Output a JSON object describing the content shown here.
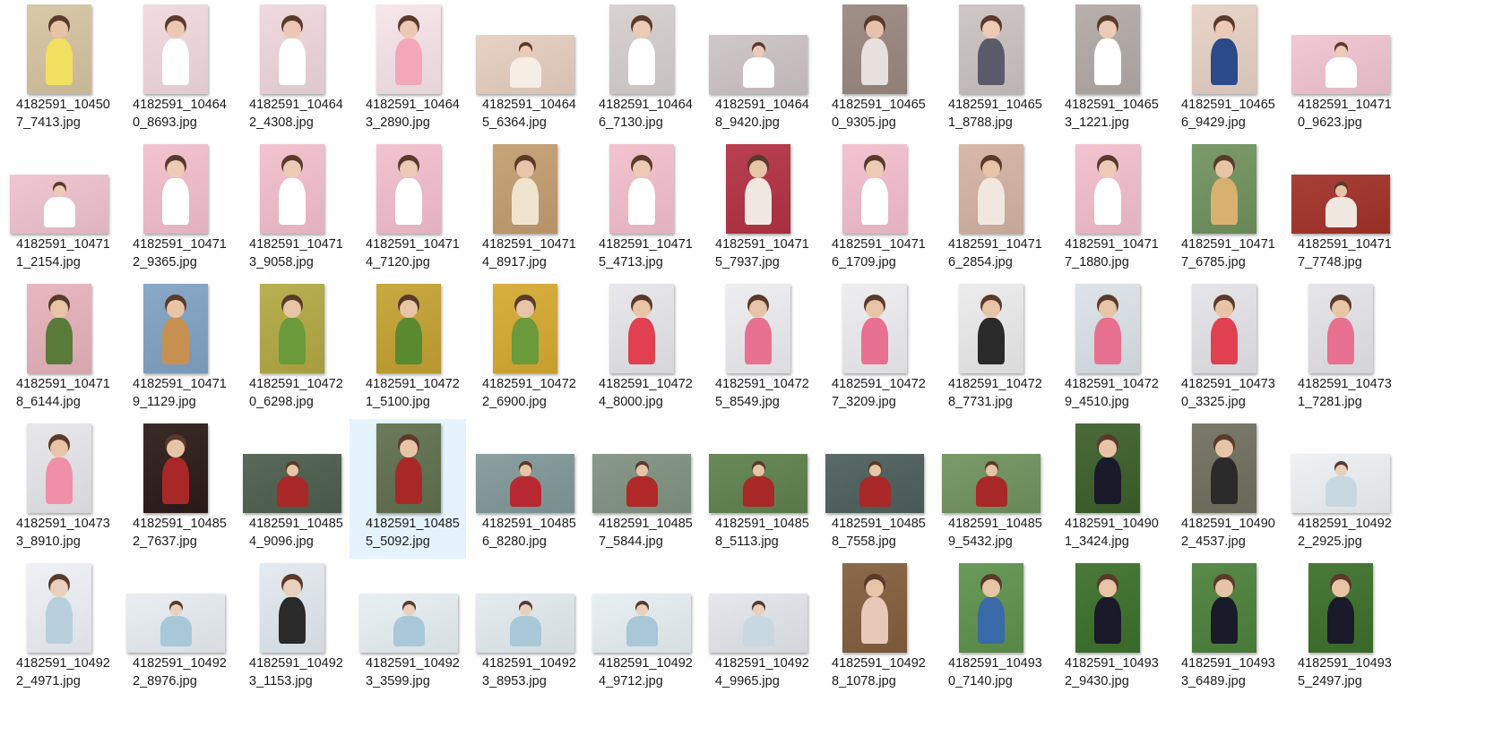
{
  "selected_index": 39,
  "files": [
    {
      "line1": "4182591_10450",
      "line2": "7_7413.jpg",
      "orient": "portrait",
      "bg": "#d9c8a8",
      "fg": "#f2e060",
      "skin": "#e8c2a4"
    },
    {
      "line1": "4182591_10464",
      "line2": "0_8693.jpg",
      "orient": "portrait",
      "bg": "#f3dbe2",
      "fg": "#ffffff",
      "skin": "#ecc8b4"
    },
    {
      "line1": "4182591_10464",
      "line2": "2_4308.jpg",
      "orient": "portrait",
      "bg": "#f0dade",
      "fg": "#ffffff",
      "skin": "#ecc8b4"
    },
    {
      "line1": "4182591_10464",
      "line2": "3_2890.jpg",
      "orient": "portrait",
      "bg": "#f7e6ea",
      "fg": "#f3a7b8",
      "skin": "#ecc8b4"
    },
    {
      "line1": "4182591_10464",
      "line2": "5_6364.jpg",
      "orient": "landscape",
      "bg": "#e8d2c4",
      "fg": "#f6ede6",
      "skin": "#eccab6"
    },
    {
      "line1": "4182591_10464",
      "line2": "6_7130.jpg",
      "orient": "portrait",
      "bg": "#d8d2d0",
      "fg": "#ffffff",
      "skin": "#eccab6"
    },
    {
      "line1": "4182591_10464",
      "line2": "8_9420.jpg",
      "orient": "landscape",
      "bg": "#cfc8c6",
      "fg": "#ffffff",
      "skin": "#eccab6"
    },
    {
      "line1": "4182591_10465",
      "line2": "0_9305.jpg",
      "orient": "portrait",
      "bg": "#a09088",
      "fg": "#e8e0dc",
      "skin": "#e6c2ae"
    },
    {
      "line1": "4182591_10465",
      "line2": "1_8788.jpg",
      "orient": "portrait",
      "bg": "#cfc7c6",
      "fg": "#5a5a6a",
      "skin": "#eccab6"
    },
    {
      "line1": "4182591_10465",
      "line2": "3_1221.jpg",
      "orient": "portrait",
      "bg": "#b8b0ac",
      "fg": "#ffffff",
      "skin": "#eccab6"
    },
    {
      "line1": "4182591_10465",
      "line2": "6_9429.jpg",
      "orient": "portrait",
      "bg": "#e8d4c8",
      "fg": "#2a4a8a",
      "skin": "#eccab6"
    },
    {
      "line1": "4182591_10471",
      "line2": "0_9623.jpg",
      "orient": "landscape",
      "bg": "#f2c8d4",
      "fg": "#ffffff",
      "skin": "#eccab6"
    },
    {
      "line1": "4182591_10471",
      "line2": "1_2154.jpg",
      "orient": "landscape",
      "bg": "#f0c6d2",
      "fg": "#ffffff",
      "skin": "#eccab6"
    },
    {
      "line1": "4182591_10471",
      "line2": "2_9365.jpg",
      "orient": "portrait",
      "bg": "#f3c4d0",
      "fg": "#ffffff",
      "skin": "#eccab6"
    },
    {
      "line1": "4182591_10471",
      "line2": "3_9058.jpg",
      "orient": "portrait",
      "bg": "#f3c4d0",
      "fg": "#ffffff",
      "skin": "#eccab6"
    },
    {
      "line1": "4182591_10471",
      "line2": "4_7120.jpg",
      "orient": "portrait",
      "bg": "#f3c4d0",
      "fg": "#ffffff",
      "skin": "#eccab6"
    },
    {
      "line1": "4182591_10471",
      "line2": "4_8917.jpg",
      "orient": "portrait",
      "bg": "#c8a47a",
      "fg": "#efe4d0",
      "skin": "#e8c4a6"
    },
    {
      "line1": "4182591_10471",
      "line2": "5_4713.jpg",
      "orient": "portrait",
      "bg": "#f3c4d0",
      "fg": "#ffffff",
      "skin": "#eccab6"
    },
    {
      "line1": "4182591_10471",
      "line2": "5_7937.jpg",
      "orient": "portrait",
      "bg": "#b84050",
      "fg": "#f0e8e0",
      "skin": "#e8c4a6"
    },
    {
      "line1": "4182591_10471",
      "line2": "6_1709.jpg",
      "orient": "portrait",
      "bg": "#f3c4d0",
      "fg": "#ffffff",
      "skin": "#eccab6"
    },
    {
      "line1": "4182591_10471",
      "line2": "6_2854.jpg",
      "orient": "portrait",
      "bg": "#d8b8a8",
      "fg": "#f0e8e0",
      "skin": "#e8c4a6"
    },
    {
      "line1": "4182591_10471",
      "line2": "7_1880.jpg",
      "orient": "portrait",
      "bg": "#f3c4d0",
      "fg": "#ffffff",
      "skin": "#eccab6"
    },
    {
      "line1": "4182591_10471",
      "line2": "7_6785.jpg",
      "orient": "portrait",
      "bg": "#7a9a6a",
      "fg": "#d8b070",
      "skin": "#e8c4a6"
    },
    {
      "line1": "4182591_10471",
      "line2": "7_7748.jpg",
      "orient": "landscape",
      "bg": "#a84038",
      "fg": "#f0e8e0",
      "skin": "#e8c4a6"
    },
    {
      "line1": "4182591_10471",
      "line2": "8_6144.jpg",
      "orient": "portrait",
      "bg": "#e8b8c0",
      "fg": "#5a7a3a",
      "skin": "#e8c4a6"
    },
    {
      "line1": "4182591_10471",
      "line2": "9_1129.jpg",
      "orient": "portrait",
      "bg": "#8aa8c8",
      "fg": "#c89050",
      "skin": "#e8c4a6"
    },
    {
      "line1": "4182591_10472",
      "line2": "0_6298.jpg",
      "orient": "portrait",
      "bg": "#b8b050",
      "fg": "#6a9a3a",
      "skin": "#e8c4a6"
    },
    {
      "line1": "4182591_10472",
      "line2": "1_5100.jpg",
      "orient": "portrait",
      "bg": "#c8a840",
      "fg": "#5a8a30",
      "skin": "#e8c4a6"
    },
    {
      "line1": "4182591_10472",
      "line2": "2_6900.jpg",
      "orient": "portrait",
      "bg": "#d8b040",
      "fg": "#6a9a3a",
      "skin": "#e8c4a6"
    },
    {
      "line1": "4182591_10472",
      "line2": "4_8000.jpg",
      "orient": "portrait",
      "bg": "#e8e8ec",
      "fg": "#e04050",
      "skin": "#e8c4a6"
    },
    {
      "line1": "4182591_10472",
      "line2": "5_8549.jpg",
      "orient": "portrait",
      "bg": "#eeeef0",
      "fg": "#e87090",
      "skin": "#e8c4a6"
    },
    {
      "line1": "4182591_10472",
      "line2": "7_3209.jpg",
      "orient": "portrait",
      "bg": "#eeeef0",
      "fg": "#e87090",
      "skin": "#e8c4a6"
    },
    {
      "line1": "4182591_10472",
      "line2": "8_7731.jpg",
      "orient": "portrait",
      "bg": "#ececec",
      "fg": "#2a2a2a",
      "skin": "#e8c4a6"
    },
    {
      "line1": "4182591_10472",
      "line2": "9_4510.jpg",
      "orient": "portrait",
      "bg": "#dde4ea",
      "fg": "#e87090",
      "skin": "#e8c4a6"
    },
    {
      "line1": "4182591_10473",
      "line2": "0_3325.jpg",
      "orient": "portrait",
      "bg": "#e6e6ea",
      "fg": "#e04050",
      "skin": "#e8c4a6"
    },
    {
      "line1": "4182591_10473",
      "line2": "1_7281.jpg",
      "orient": "portrait",
      "bg": "#e6e6ea",
      "fg": "#e87090",
      "skin": "#e8c4a6"
    },
    {
      "line1": "4182591_10473",
      "line2": "3_8910.jpg",
      "orient": "portrait",
      "bg": "#e8e8ec",
      "fg": "#f090a8",
      "skin": "#e8c4a6"
    },
    {
      "line1": "4182591_10485",
      "line2": "2_7637.jpg",
      "orient": "portrait",
      "bg": "#3a2a28",
      "fg": "#a82828",
      "skin": "#e8c4a6"
    },
    {
      "line1": "4182591_10485",
      "line2": "4_9096.jpg",
      "orient": "landscape",
      "bg": "#5a6a5a",
      "fg": "#a82828",
      "skin": "#e8c4a6"
    },
    {
      "line1": "4182591_10485",
      "line2": "5_5092.jpg",
      "orient": "portrait",
      "bg": "#6a7a5a",
      "fg": "#a82828",
      "skin": "#e8c4a6"
    },
    {
      "line1": "4182591_10485",
      "line2": "6_8280.jpg",
      "orient": "landscape",
      "bg": "#8aa0a0",
      "fg": "#b82830",
      "skin": "#e8c4a6"
    },
    {
      "line1": "4182591_10485",
      "line2": "7_5844.jpg",
      "orient": "landscape",
      "bg": "#8a9a8a",
      "fg": "#b02828",
      "skin": "#e8c4a6"
    },
    {
      "line1": "4182591_10485",
      "line2": "8_5113.jpg",
      "orient": "landscape",
      "bg": "#6a8a5a",
      "fg": "#a82828",
      "skin": "#e8c4a6"
    },
    {
      "line1": "4182591_10485",
      "line2": "8_7558.jpg",
      "orient": "landscape",
      "bg": "#5a6a68",
      "fg": "#a82828",
      "skin": "#e8c4a6"
    },
    {
      "line1": "4182591_10485",
      "line2": "9_5432.jpg",
      "orient": "landscape",
      "bg": "#7a9a6a",
      "fg": "#a82828",
      "skin": "#e8c4a6"
    },
    {
      "line1": "4182591_10490",
      "line2": "1_3424.jpg",
      "orient": "portrait",
      "bg": "#4a6a3a",
      "fg": "#1a1a2a",
      "skin": "#e8c4a6"
    },
    {
      "line1": "4182591_10490",
      "line2": "2_4537.jpg",
      "orient": "portrait",
      "bg": "#7a7a6a",
      "fg": "#2a2a2a",
      "skin": "#e8c4a6"
    },
    {
      "line1": "4182591_10492",
      "line2": "2_2925.jpg",
      "orient": "landscape",
      "bg": "#eef2f4",
      "fg": "#c8d8e0",
      "skin": "#e8d0bc"
    },
    {
      "line1": "4182591_10492",
      "line2": "2_4971.jpg",
      "orient": "portrait",
      "bg": "#eef2f6",
      "fg": "#b8d0dc",
      "skin": "#e8d0bc"
    },
    {
      "line1": "4182591_10492",
      "line2": "2_8976.jpg",
      "orient": "landscape",
      "bg": "#e8eef2",
      "fg": "#a8c8d8",
      "skin": "#e8d0bc"
    },
    {
      "line1": "4182591_10492",
      "line2": "3_1153.jpg",
      "orient": "portrait",
      "bg": "#e4ebf0",
      "fg": "#2a2a2a",
      "skin": "#e8d0bc"
    },
    {
      "line1": "4182591_10492",
      "line2": "3_3599.jpg",
      "orient": "landscape",
      "bg": "#e8f0f4",
      "fg": "#a8c8d8",
      "skin": "#e8d0bc"
    },
    {
      "line1": "4182591_10492",
      "line2": "3_8953.jpg",
      "orient": "landscape",
      "bg": "#e4ecf0",
      "fg": "#a8c8d8",
      "skin": "#e8d0bc"
    },
    {
      "line1": "4182591_10492",
      "line2": "4_9712.jpg",
      "orient": "landscape",
      "bg": "#e8f0f4",
      "fg": "#a8c8d8",
      "skin": "#e8d0bc"
    },
    {
      "line1": "4182591_10492",
      "line2": "4_9965.jpg",
      "orient": "landscape",
      "bg": "#e4e8ec",
      "fg": "#c8d8e0",
      "skin": "#e8d0bc"
    },
    {
      "line1": "4182591_10492",
      "line2": "8_1078.jpg",
      "orient": "portrait",
      "bg": "#8a6a4a",
      "fg": "#e8c8b8",
      "skin": "#e8c4a6"
    },
    {
      "line1": "4182591_10493",
      "line2": "0_7140.jpg",
      "orient": "portrait",
      "bg": "#6a9a5a",
      "fg": "#3a6aa8",
      "skin": "#e8c4a6"
    },
    {
      "line1": "4182591_10493",
      "line2": "2_9430.jpg",
      "orient": "portrait",
      "bg": "#4a7a3a",
      "fg": "#1a1a2a",
      "skin": "#e8c4a6"
    },
    {
      "line1": "4182591_10493",
      "line2": "3_6489.jpg",
      "orient": "portrait",
      "bg": "#5a8a4a",
      "fg": "#1a1a2a",
      "skin": "#e8c4a6"
    },
    {
      "line1": "4182591_10493",
      "line2": "5_2497.jpg",
      "orient": "portrait",
      "bg": "#4a7a3a",
      "fg": "#1a1a2a",
      "skin": "#e8c4a6"
    }
  ]
}
